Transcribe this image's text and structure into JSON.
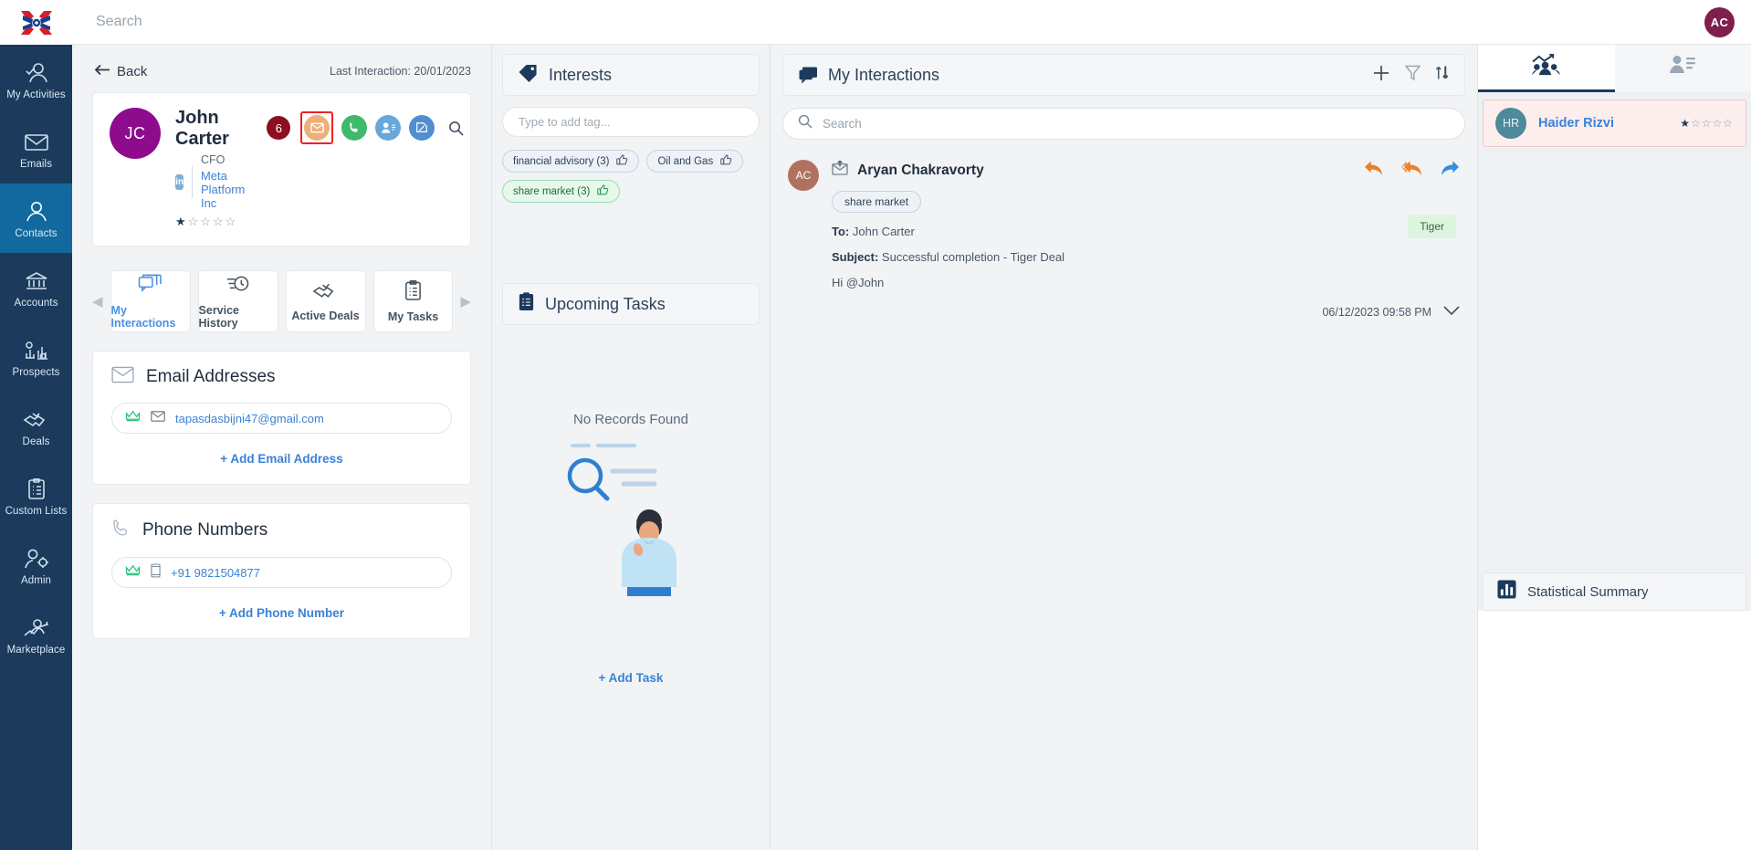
{
  "topbar": {
    "search_placeholder": "Search",
    "avatar_initials": "AC"
  },
  "leftnav": {
    "items": [
      {
        "label": "My Activities",
        "icon": "user-check-icon",
        "active": false
      },
      {
        "label": "Emails",
        "icon": "envelope-icon",
        "active": false
      },
      {
        "label": "Contacts",
        "icon": "user-icon",
        "active": true
      },
      {
        "label": "Accounts",
        "icon": "bank-icon",
        "active": false
      },
      {
        "label": "Prospects",
        "icon": "chart-gears-icon",
        "active": false
      },
      {
        "label": "Deals",
        "icon": "handshake-check-icon",
        "active": false
      },
      {
        "label": "Custom Lists",
        "icon": "clipboard-list-icon",
        "active": false
      },
      {
        "label": "Admin",
        "icon": "user-gear-icon",
        "active": false
      },
      {
        "label": "Marketplace",
        "icon": "user-trend-icon",
        "active": false
      }
    ]
  },
  "contact": {
    "back_label": "Back",
    "last_interaction": "Last Interaction: 20/01/2023",
    "avatar_initials": "JC",
    "name": "John Carter",
    "linkedin_badge": "in",
    "role": "CFO",
    "company": "Meta Platform Inc",
    "rating_filled": 1,
    "rating_total": 5,
    "notification_count": "6",
    "actions": [
      {
        "name": "email-action",
        "icon": "envelope-icon",
        "highlighted": true
      },
      {
        "name": "call-action",
        "icon": "phone-icon",
        "highlighted": false
      },
      {
        "name": "meeting-action",
        "icon": "people-icon",
        "highlighted": false
      },
      {
        "name": "note-action",
        "icon": "pencil-note-icon",
        "highlighted": false
      },
      {
        "name": "search-action",
        "icon": "search-icon",
        "highlighted": false
      }
    ],
    "tabs": [
      {
        "label": "My Interactions",
        "icon": "chat-stack-icon",
        "active": true
      },
      {
        "label": "Service History",
        "icon": "clock-history-icon",
        "active": false
      },
      {
        "label": "Active Deals",
        "icon": "handshake-check-icon",
        "active": false
      },
      {
        "label": "My Tasks",
        "icon": "clipboard-icon",
        "active": false
      }
    ],
    "email_section": {
      "title": "Email Addresses",
      "icon": "envelope-icon",
      "items": [
        {
          "value": "tapasdasbijni47@gmail.com",
          "primary": true
        }
      ],
      "add_label": "+ Add Email Address"
    },
    "phone_section": {
      "title": "Phone Numbers",
      "icon": "phone-icon",
      "items": [
        {
          "value": "+91 9821504877",
          "primary": true
        }
      ],
      "add_label": "+ Add Phone Number"
    }
  },
  "interests": {
    "title": "Interests",
    "icon": "tag-icon",
    "input_placeholder": "Type to add tag...",
    "tags": [
      {
        "label": "financial advisory (3)",
        "style": "blue"
      },
      {
        "label": "Oil and Gas",
        "style": "blue"
      },
      {
        "label": "share market (3)",
        "style": "green"
      }
    ]
  },
  "upcoming_tasks": {
    "title": "Upcoming Tasks",
    "icon": "clipboard-list-icon",
    "empty_text": "No Records Found",
    "add_label": "+ Add Task"
  },
  "my_interactions": {
    "title": "My Interactions",
    "icon": "chat-stack-icon",
    "header_actions": [
      {
        "name": "add-interaction-button",
        "icon": "plus-icon"
      },
      {
        "name": "filter-button",
        "icon": "funnel-icon"
      },
      {
        "name": "sort-button",
        "icon": "sort-icon"
      }
    ],
    "search_placeholder": "Search",
    "messages": [
      {
        "avatar_initials": "AC",
        "sender": "Aryan Chakravorty",
        "tag": "share market",
        "to_label": "To:",
        "to_value": "John Carter",
        "subject_label": "Subject:",
        "subject_value": "Successful completion - Tiger Deal",
        "body": "Hi @John",
        "deal_chip": "Tiger",
        "date": "06/12/2023 09:58 PM"
      }
    ]
  },
  "right_panel": {
    "tabs": [
      {
        "name": "team-tab",
        "icon": "team-trend-icon",
        "active": true
      },
      {
        "name": "contact-details-tab",
        "icon": "user-details-icon",
        "active": false
      }
    ],
    "people": [
      {
        "avatar_initials": "HR",
        "name": "Haider Rizvi",
        "rating_filled": 1,
        "rating_total": 5
      }
    ],
    "statistical_summary": {
      "title": "Statistical Summary",
      "icon": "bar-chart-icon"
    }
  }
}
